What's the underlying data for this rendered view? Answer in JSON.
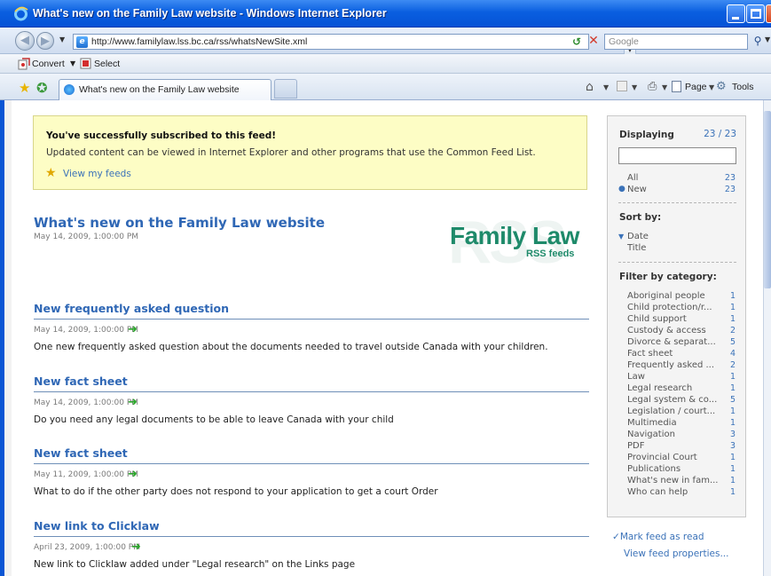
{
  "window": {
    "title": "What's new on the Family Law website - Windows Internet Explorer"
  },
  "address_bar": {
    "url": "http://www.familylaw.lss.bc.ca/rss/whatsNewSite.xml",
    "search_placeholder": "Google"
  },
  "links_bar": {
    "convert_label": "Convert",
    "select_label": "Select"
  },
  "tab": {
    "label": "What's new on the Family Law website"
  },
  "command_bar": {
    "page_label": "Page",
    "tools_label": "Tools"
  },
  "notice": {
    "title": "You've successfully subscribed to this feed!",
    "text": "Updated content can be viewed in Internet Explorer and other programs that use the Common Feed List.",
    "link": "View my feeds"
  },
  "feed": {
    "title": "What's new on the Family Law website",
    "date": "May 14, 2009, 1:00:00 PM",
    "logo_main": "Family Law",
    "logo_sub": "RSS feeds",
    "logo_bg": "RSS"
  },
  "entries": [
    {
      "title": "New frequently asked question",
      "date": "May 14, 2009, 1:00:00 PM",
      "description": "One new frequently asked question about the documents needed to travel outside Canada with your children."
    },
    {
      "title": "New fact sheet",
      "date": "May 14, 2009, 1:00:00 PM",
      "description": "Do you need any legal documents to be able to leave Canada with your child"
    },
    {
      "title": "New fact sheet",
      "date": "May 11, 2009, 1:00:00 PM",
      "description": "What to do if the other party does not respond to your application to get a court Order"
    },
    {
      "title": "New link to Clicklaw",
      "date": "April 23, 2009, 1:00:00 PM",
      "description": "New link to Clicklaw added under \"Legal research\" on the Links page"
    }
  ],
  "sidebar": {
    "displaying_label": "Displaying",
    "displaying_count": "23 / 23",
    "filters": [
      {
        "label": "All",
        "count": "23"
      },
      {
        "label": "New",
        "count": "23"
      }
    ],
    "sort_heading": "Sort by:",
    "sort_options": [
      "Date",
      "Title"
    ],
    "category_heading": "Filter by category:",
    "categories": [
      {
        "label": "Aboriginal people",
        "count": "1"
      },
      {
        "label": "Child protection/r...",
        "count": "1"
      },
      {
        "label": "Child support",
        "count": "1"
      },
      {
        "label": "Custody & access",
        "count": "2"
      },
      {
        "label": "Divorce & separat...",
        "count": "5"
      },
      {
        "label": "Fact sheet",
        "count": "4"
      },
      {
        "label": "Frequently asked ...",
        "count": "2"
      },
      {
        "label": "Law",
        "count": "1"
      },
      {
        "label": "Legal research",
        "count": "1"
      },
      {
        "label": "Legal system & co...",
        "count": "5"
      },
      {
        "label": "Legislation / court...",
        "count": "1"
      },
      {
        "label": "Multimedia",
        "count": "1"
      },
      {
        "label": "Navigation",
        "count": "3"
      },
      {
        "label": "PDF",
        "count": "3"
      },
      {
        "label": "Provincial Court",
        "count": "1"
      },
      {
        "label": "Publications",
        "count": "1"
      },
      {
        "label": "What's new in fam...",
        "count": "1"
      },
      {
        "label": "Who can help",
        "count": "1"
      }
    ],
    "mark_read": "Mark feed as read",
    "feed_properties": "View feed properties..."
  },
  "colors": {
    "link_blue": "#3b72b8",
    "title_blue": "#2f67b5",
    "notice_yellow": "#fdfdc5",
    "logo_green": "#1e8a6a",
    "arrow_green": "#2aa52a"
  }
}
